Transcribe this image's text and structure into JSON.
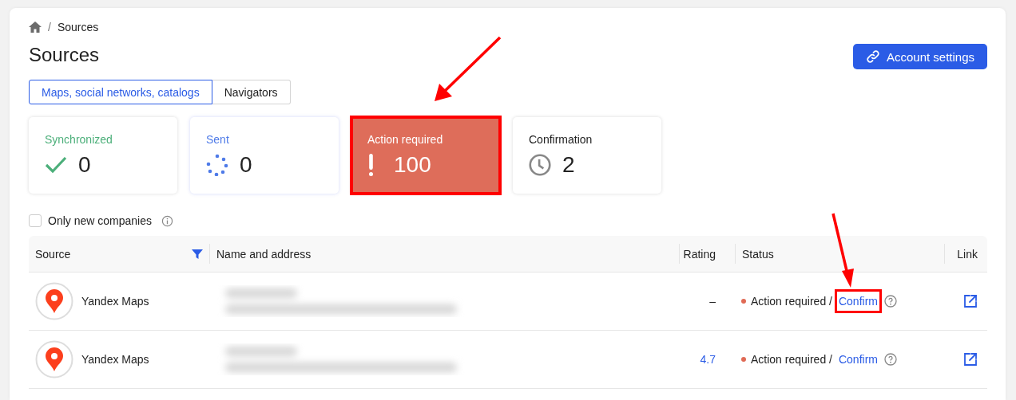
{
  "breadcrumb": {
    "separator": "/",
    "current": "Sources"
  },
  "title": "Sources",
  "account_button": "Account settings",
  "tabs": [
    {
      "label": "Maps, social networks, catalogs",
      "selected": true
    },
    {
      "label": "Navigators",
      "selected": false
    }
  ],
  "cards": [
    {
      "kind": "synced",
      "label": "Synchronized",
      "count": "0",
      "highlighted": false
    },
    {
      "kind": "sent",
      "label": "Sent",
      "count": "0",
      "highlighted": false
    },
    {
      "kind": "action",
      "label": "Action required",
      "count": "100",
      "highlighted": true
    },
    {
      "kind": "confirmation",
      "label": "Confirmation",
      "count": "2",
      "highlighted": false
    }
  ],
  "filter": {
    "label": "Only new companies",
    "checked": false
  },
  "table": {
    "columns": [
      "Source",
      "Name and address",
      "Rating",
      "Status",
      "Link"
    ],
    "rows": [
      {
        "source": "Yandex Maps",
        "rating": "–",
        "rating_link": false,
        "status": "Action required /",
        "kind": "action",
        "action": "Confirm",
        "highlighted": true
      },
      {
        "source": "Yandex Maps",
        "rating": "4.7",
        "rating_link": true,
        "status": "Action required /",
        "kind": "action",
        "action": "Confirm",
        "highlighted": false
      }
    ]
  }
}
